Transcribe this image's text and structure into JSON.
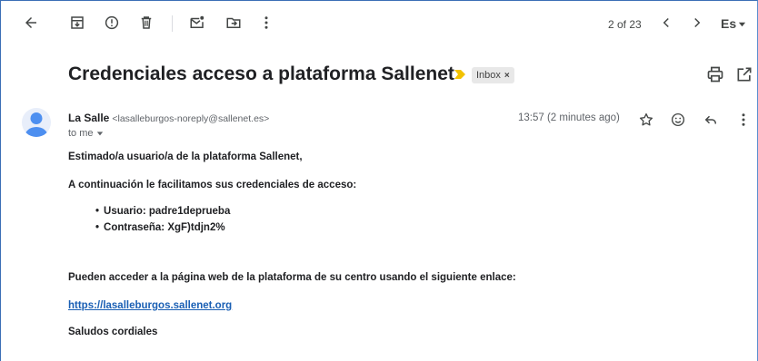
{
  "toolbar": {
    "back_icon": "arrow-left-icon",
    "archive_icon": "archive-icon",
    "spam_icon": "report-spam-icon",
    "delete_icon": "trash-icon",
    "unread_icon": "mark-unread-icon",
    "move_icon": "move-to-icon",
    "more_icon": "more-vert-icon",
    "pager": "2 of 23",
    "language": "Es"
  },
  "email": {
    "subject": "Credenciales acceso a plataforma Sallenet",
    "label": "Inbox",
    "label_close": "×",
    "sender_name": "La Salle",
    "sender_email": "<lasalleburgos-noreply@sallenet.es>",
    "recipient": "to me",
    "timestamp": "13:57 (2 minutes ago)",
    "greeting": "Estimado/a usuario/a de la plataforma Sallenet,",
    "intro": "A continuación le facilitamos sus credenciales de acceso:",
    "credentials": [
      "Usuario: padre1deprueba",
      "Contraseña: XgF)tdjn2%"
    ],
    "access_text": "Pueden acceder a la página web de la plataforma de su centro usando el siguiente enlace:",
    "link": "https://lasalleburgos.sallenet.org",
    "closing": "Saludos cordiales"
  },
  "colors": {
    "importance": "#f2c200",
    "link": "#1a5fb4",
    "avatar": "#4d8ff0"
  }
}
